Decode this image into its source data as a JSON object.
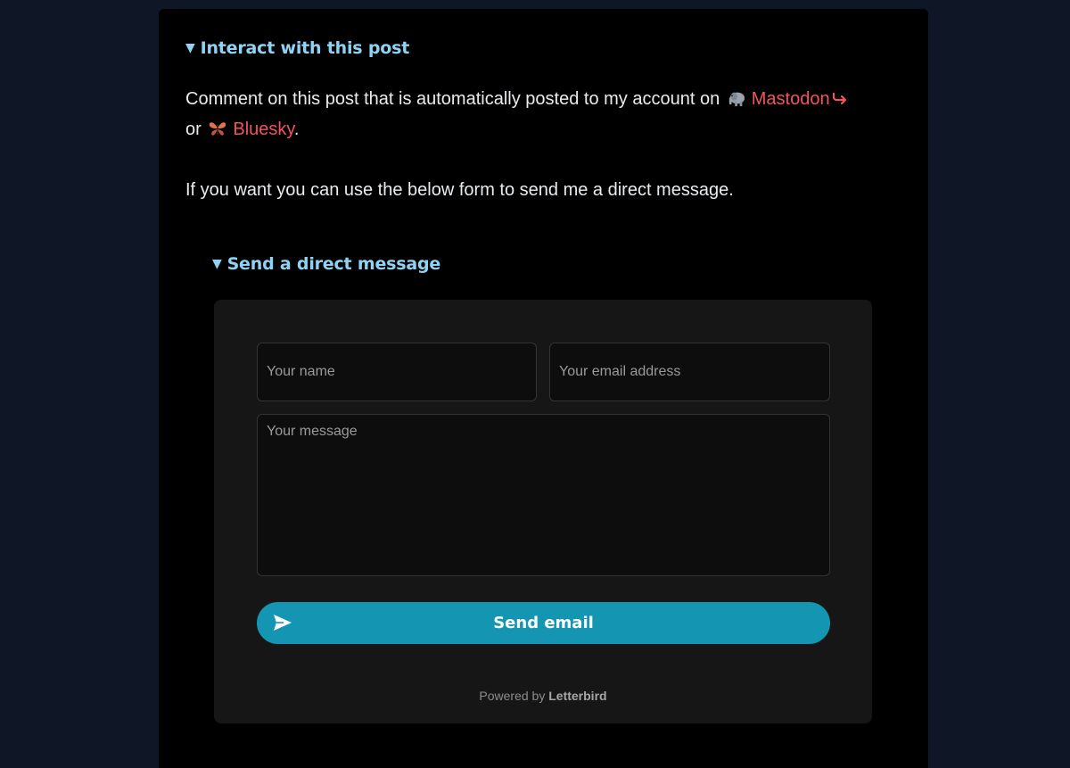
{
  "post_section": {
    "summary": "Interact with this post",
    "comment_text_prefix": "Comment on this post that is automatically posted to my account on",
    "mastodon_icon": "elephant-emoji-icon",
    "mastodon_link": "Mastodon",
    "external_icon": "external-link-arrow-icon",
    "or_text": "or",
    "bluesky_icon": "butterfly-emoji-icon",
    "bluesky_link": "Bluesky",
    "period": ".",
    "direct_message_text": "If you want you can use the below form to send me a direct message."
  },
  "dm_section": {
    "summary": "Send a direct message",
    "name_placeholder": "Your name",
    "email_placeholder": "Your email address",
    "message_placeholder": "Your message",
    "send_label": "Send email",
    "send_icon": "paper-plane-icon",
    "powered_prefix": "Powered by",
    "powered_brand": "Letterbird"
  },
  "colors": {
    "page_bg": "#0f1727",
    "card_bg": "#000000",
    "summary": "#8fd3f4",
    "link": "#f2545b",
    "button": "#1496b3"
  }
}
